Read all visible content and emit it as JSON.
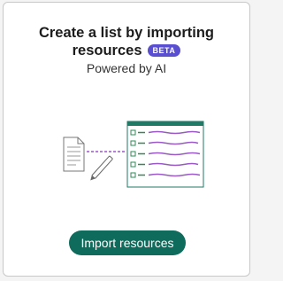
{
  "card": {
    "title_line1": "Create a list by importing",
    "title_line2": "resources",
    "badge": "BETA",
    "subtitle": "Powered by AI",
    "import_button_label": "Import resources"
  },
  "colors": {
    "badge": "#5a4fcf",
    "button": "#0f6b5c",
    "list_header": "#1f7a66",
    "list_line": "#9b59c6",
    "check_box": "#2e8b57"
  },
  "illustration_icons": [
    "document-icon",
    "pen-icon",
    "list-panel-icon"
  ]
}
